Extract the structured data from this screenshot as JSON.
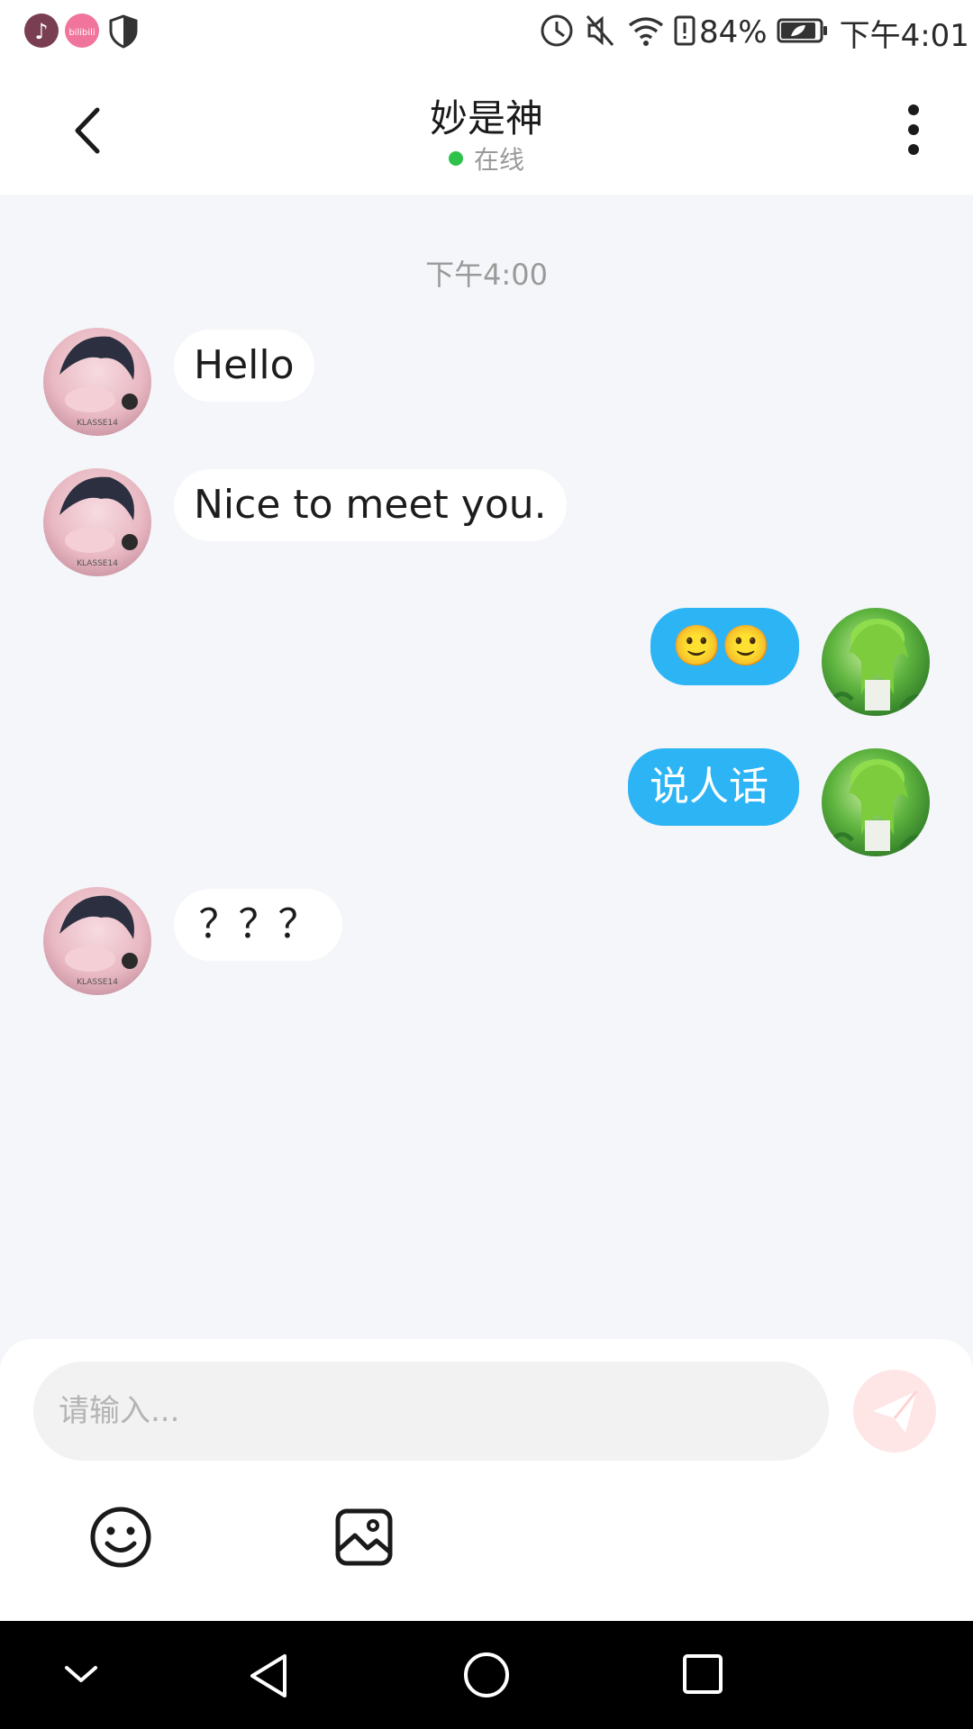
{
  "status_bar": {
    "apps": [
      "tiktok-icon",
      "bilibili-icon",
      "shield-icon"
    ],
    "bilibili_label": "bilibili",
    "battery": "84%",
    "time": "下午4:01",
    "icons": [
      "data-saver-icon",
      "mute-icon",
      "wifi-icon",
      "alert-icon",
      "battery-icon"
    ]
  },
  "header": {
    "title": "妙是神",
    "status": "在线",
    "status_color": "#2ec24a"
  },
  "chat": {
    "timestamp": "下午4:00",
    "messages": [
      {
        "side": "incoming",
        "text": "Hello"
      },
      {
        "side": "incoming",
        "text": "Nice to meet you."
      },
      {
        "side": "outgoing",
        "text": "🙂🙂"
      },
      {
        "side": "outgoing",
        "text": "说人话"
      },
      {
        "side": "incoming",
        "text": "？？？"
      }
    ],
    "avatar_watermark": "KLASSE14"
  },
  "composer": {
    "placeholder": "请输入...",
    "tools": [
      "emoji-icon",
      "image-icon"
    ]
  },
  "colors": {
    "accent_bubble": "#2db4f5",
    "send_button": "#ffe6e6",
    "online": "#2ec24a"
  },
  "nav_bar": {
    "buttons": [
      "hide-keyboard-icon",
      "back-triangle-icon",
      "home-circle-icon",
      "recents-square-icon"
    ]
  }
}
